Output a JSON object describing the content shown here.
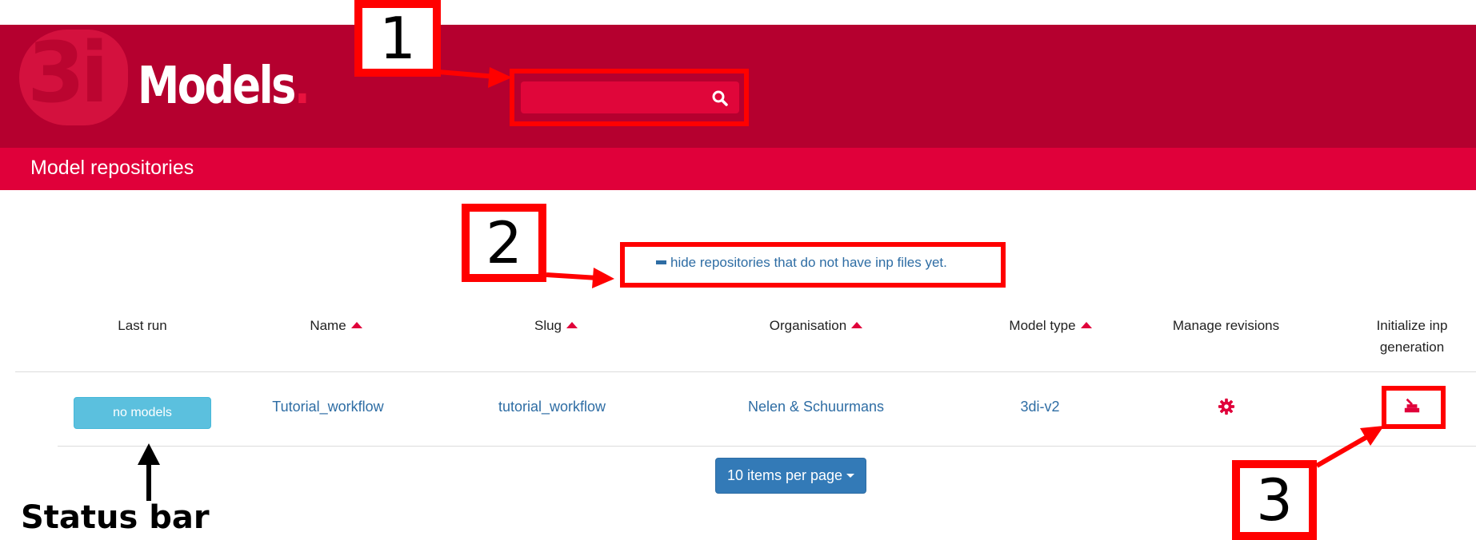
{
  "header": {
    "logo_mark": "3Di",
    "logo_text": "Models",
    "logo_dot": ".",
    "search": {
      "value": "",
      "placeholder": ""
    }
  },
  "subheader": {
    "title": "Model repositories"
  },
  "filter": {
    "label": "hide repositories that do not have inp files yet."
  },
  "table": {
    "columns": [
      {
        "label": "Last run",
        "sortable": false
      },
      {
        "label": "Name",
        "sortable": true
      },
      {
        "label": "Slug",
        "sortable": true
      },
      {
        "label": "Organisation",
        "sortable": true
      },
      {
        "label": "Model type",
        "sortable": true
      },
      {
        "label": "Manage revisions",
        "sortable": false
      },
      {
        "label": "Initialize inp generation",
        "sortable": false
      }
    ],
    "rows": [
      {
        "status": "no models",
        "name": "Tutorial_workflow",
        "slug": "tutorial_workflow",
        "organisation": "Nelen & Schuurmans",
        "model_type": "3di-v2",
        "manage_icon": "gear-icon",
        "init_icon": "inp-generation-icon"
      }
    ]
  },
  "pagination": {
    "label": "10 items per page"
  },
  "annotations": {
    "markers": [
      "1",
      "2",
      "3"
    ],
    "status_label": "Status bar"
  },
  "colors": {
    "header": "#b5002f",
    "subheader": "#e0003a",
    "accent": "#e0003a",
    "link": "#2e6da4",
    "status_info": "#5bc0de",
    "button_primary": "#337ab7",
    "annotation": "#ff0000"
  }
}
